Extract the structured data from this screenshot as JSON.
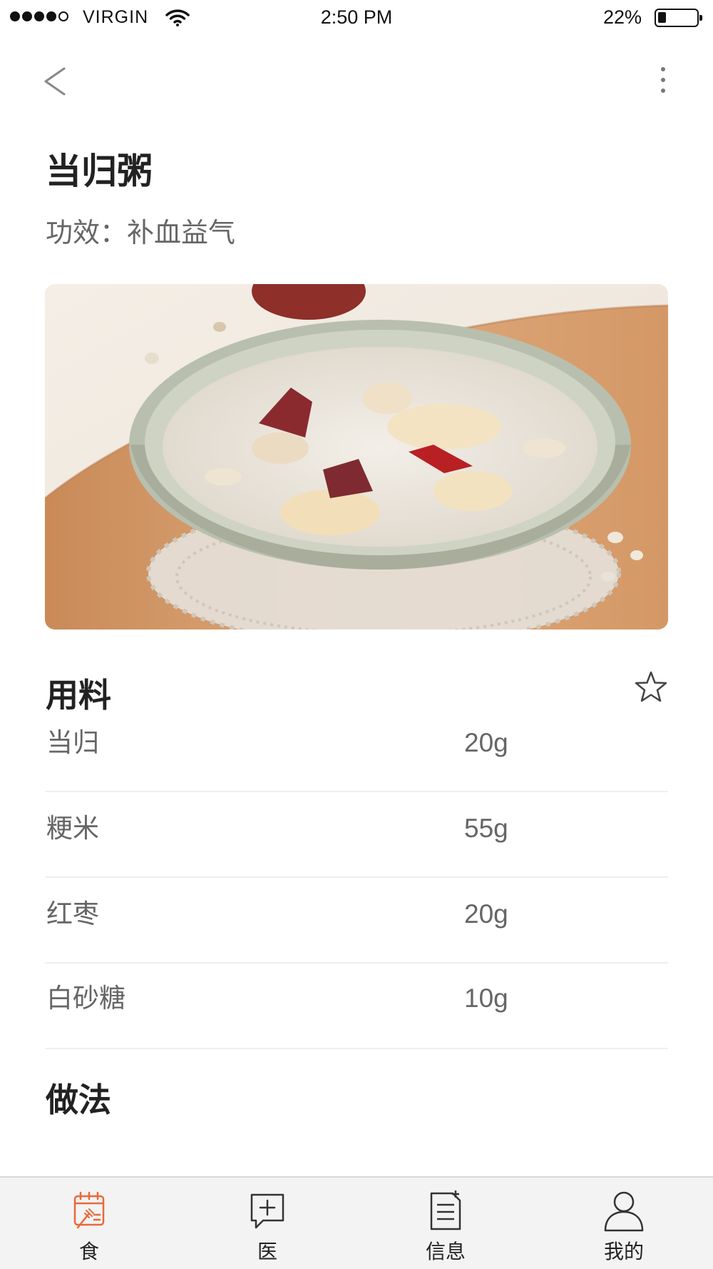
{
  "status_bar": {
    "carrier": "VIRGIN",
    "time": "2:50 PM",
    "battery_percent": "22%",
    "battery_level": 0.22
  },
  "recipe": {
    "title": "当归粥",
    "effect": "功效：补血益气",
    "image_icon": "porridge-photo"
  },
  "ingredients": {
    "heading": "用料",
    "items": [
      {
        "name": "当归",
        "amount": "20g"
      },
      {
        "name": "粳米",
        "amount": "55g"
      },
      {
        "name": "红枣",
        "amount": "20g"
      },
      {
        "name": "白砂糖",
        "amount": "10g"
      }
    ]
  },
  "method": {
    "heading": "做法"
  },
  "tabs": [
    {
      "label": "食",
      "icon": "food-icon",
      "active": true
    },
    {
      "label": "医",
      "icon": "medical-chat-icon",
      "active": false
    },
    {
      "label": "信息",
      "icon": "document-icon",
      "active": false
    },
    {
      "label": "我的",
      "icon": "user-icon",
      "active": false
    }
  ],
  "colors": {
    "accent": "#e8693a",
    "text_dark": "#222222",
    "text_muted": "#666666",
    "tab_bar_bg": "#f3f3f3"
  }
}
